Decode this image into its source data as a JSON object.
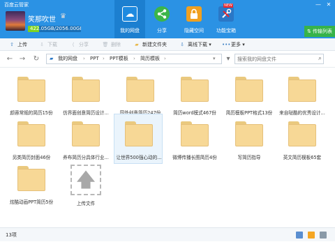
{
  "window": {
    "title": "百度云管家",
    "minimize": "—",
    "close": "✕"
  },
  "user": {
    "name": "笑那吹世",
    "quota_text": "422.05GB/2056.00GB",
    "quota_used_fraction": 0.205,
    "vip_icon": "crown-icon"
  },
  "nav_tabs": [
    {
      "label": "我的网盘",
      "icon": "cloud-icon",
      "color": "#1e8ae0",
      "active": true
    },
    {
      "label": "分享",
      "icon": "share-icon",
      "color": "#3cb54a"
    },
    {
      "label": "隐藏空间",
      "icon": "lock-icon",
      "color": "#f0a020"
    },
    {
      "label": "功能宝箱",
      "icon": "toolbox-icon",
      "color": "#2a77c6",
      "badge": "NEW"
    }
  ],
  "transfer_button": "传输列表",
  "toolbar": {
    "upload": "上传",
    "download": "下载",
    "share": "分享",
    "delete": "删除",
    "new_folder": "新建文件夹",
    "offline_download": "离线下载",
    "more": "更多"
  },
  "breadcrumb": [
    "我的网盘",
    "PPT",
    "PPT模板",
    "简历模板"
  ],
  "search": {
    "placeholder": "搜索我的网盘文件"
  },
  "files": [
    {
      "name": "颜蓉常规的简历15份"
    },
    {
      "name": "仿界面创意简历设计..."
    },
    {
      "name": "国外创意简历247份"
    },
    {
      "name": "简历word模式467份"
    },
    {
      "name": "简历模板PPT格式13份"
    },
    {
      "name": "来自哒酷的优秀设计..."
    },
    {
      "name": "另类简历封面46份"
    },
    {
      "name": "养布简历分具体行业..."
    },
    {
      "name": "让世界500强心动的..."
    },
    {
      "name": "微博传播长图简历4份"
    },
    {
      "name": "写简历指导"
    },
    {
      "name": "英文简历模板65套"
    },
    {
      "name": "炫酷动画PPT简历5份"
    }
  ],
  "upload_tile": "上传文件",
  "status": {
    "count": "13项"
  }
}
